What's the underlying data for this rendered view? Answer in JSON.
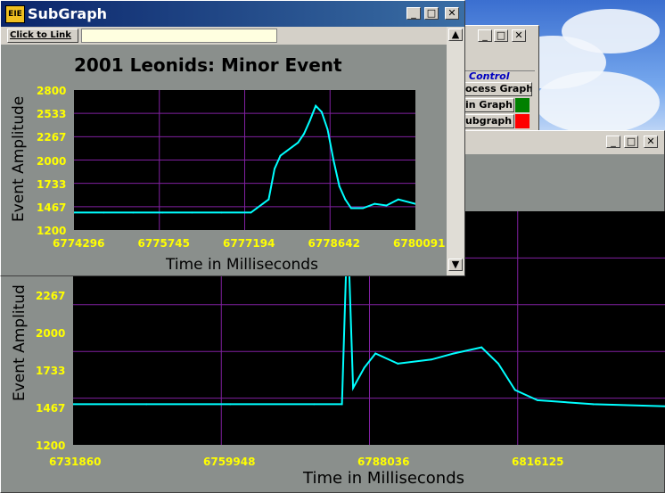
{
  "desktop": {
    "sky_color": "#4a7fd8"
  },
  "subgraph_window": {
    "title": "SubGraph",
    "link_button": "Click to Link",
    "link_input_value": "",
    "chart_title": "2001 Leonids: Minor Event",
    "xlabel": "Time in Milliseconds",
    "ylabel": "Event Amplitude",
    "yticks": [
      "2800",
      "2533",
      "2267",
      "2000",
      "1733",
      "1467",
      "1200"
    ],
    "xticks": [
      "6774296",
      "6775745",
      "6777194",
      "6778642",
      "6780091"
    ]
  },
  "control_window": {
    "title": "Control",
    "buttons": [
      "ocess Graph",
      "in Graph",
      "ubgraph"
    ],
    "indicator_colors": [
      "#008000",
      "#ff0000"
    ]
  },
  "main_window": {
    "xlabel": "Time in Milliseconds",
    "ylabel": "Event Amplitud",
    "yticks": [
      "2267",
      "2000",
      "1733",
      "1467",
      "1200"
    ],
    "xticks": [
      "6731860",
      "6759948",
      "6788036",
      "6816125"
    ]
  },
  "chart_data": [
    {
      "type": "line",
      "title": "2001 Leonids: Minor Event",
      "xlabel": "Time in Milliseconds",
      "ylabel": "Event Amplitude",
      "xlim": [
        6774296,
        6780091
      ],
      "ylim": [
        1200,
        2800
      ],
      "series": [
        {
          "color": "#00ffff",
          "x": [
            6774296,
            6774800,
            6775300,
            6775800,
            6776300,
            6776800,
            6777300,
            6777400,
            6777500,
            6777600,
            6777700,
            6777800,
            6777900,
            6778000,
            6778100,
            6778200,
            6778300,
            6778400,
            6778500,
            6778600,
            6778700,
            6778800,
            6778900,
            6779000,
            6779200,
            6779400,
            6779600,
            6779800,
            6780091
          ],
          "values": [
            1400,
            1400,
            1400,
            1400,
            1400,
            1400,
            1400,
            1450,
            1500,
            1550,
            1900,
            2050,
            2100,
            2150,
            2200,
            2300,
            2450,
            2620,
            2550,
            2350,
            2000,
            1700,
            1550,
            1450,
            1450,
            1500,
            1480,
            1550,
            1500
          ]
        }
      ]
    },
    {
      "type": "line",
      "xlabel": "Time in Milliseconds",
      "ylabel": "Event Amplitud",
      "xlim": [
        6731860,
        6838000
      ],
      "ylim": [
        1200,
        2350
      ],
      "series": [
        {
          "color": "#00ffff",
          "x": [
            6731860,
            6745000,
            6760000,
            6775000,
            6780000,
            6781000,
            6782000,
            6784000,
            6786000,
            6790000,
            6796000,
            6800000,
            6805000,
            6808000,
            6811000,
            6815000,
            6825000,
            6838000
          ],
          "values": [
            1400,
            1400,
            1400,
            1400,
            1400,
            2300,
            1480,
            1580,
            1650,
            1600,
            1620,
            1650,
            1680,
            1600,
            1470,
            1420,
            1400,
            1390
          ]
        }
      ]
    }
  ]
}
